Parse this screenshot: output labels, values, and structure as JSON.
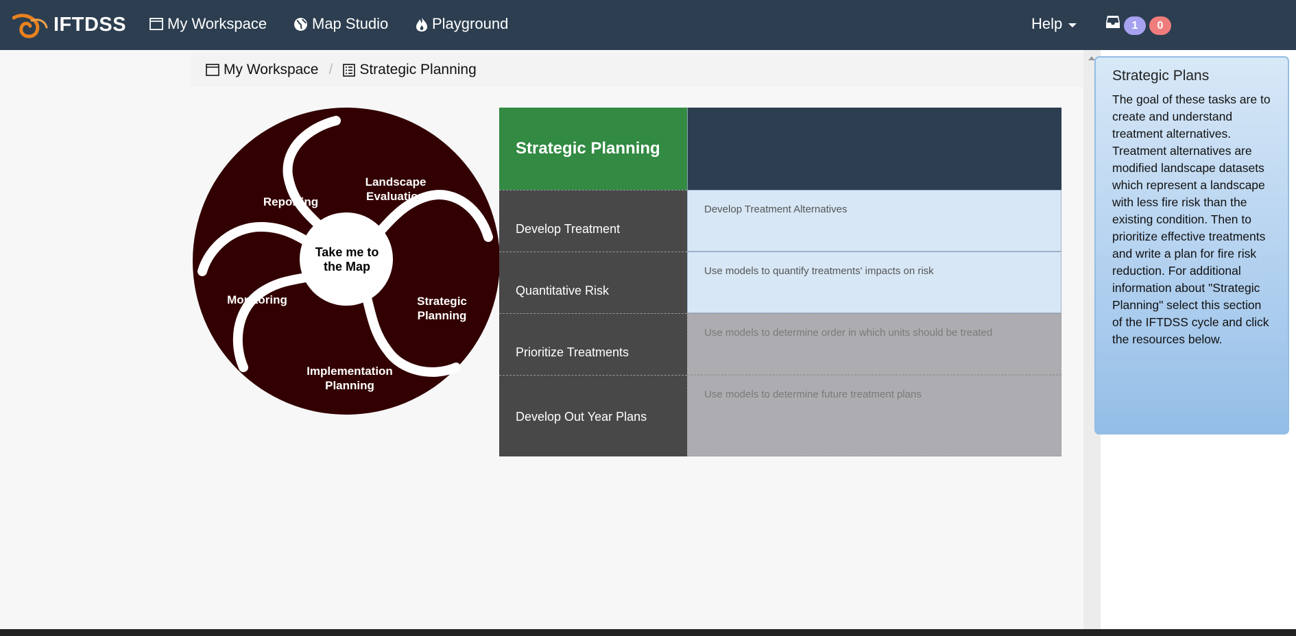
{
  "navbar": {
    "brand": "IFTDSS",
    "links": [
      {
        "label": "My Workspace",
        "icon": "window-icon"
      },
      {
        "label": "Map Studio",
        "icon": "globe-icon"
      },
      {
        "label": "Playground",
        "icon": "fire-icon"
      }
    ],
    "help_label": "Help",
    "badges": {
      "notifications": "1",
      "alerts": "0"
    },
    "colors": {
      "background": "#2c3e50",
      "badge_purple": "#a6a2f0",
      "badge_red": "#f07c7c"
    }
  },
  "breadcrumb": {
    "items": [
      {
        "label": "My Workspace",
        "icon": "window-icon"
      },
      {
        "label": "Strategic Planning",
        "icon": "list-icon"
      }
    ],
    "separator": "/"
  },
  "cycle": {
    "segments": [
      "Reporting",
      "Landscape Evaluation",
      "Strategic Planning",
      "Implementation Planning",
      "Monitoring"
    ],
    "center": "Take me to the Map",
    "color": "#320000"
  },
  "tasks": {
    "header": "Strategic Planning",
    "rows": [
      {
        "label": "Develop Treatment",
        "description": "Develop Treatment Alternatives",
        "state": "active"
      },
      {
        "label": "Quantitative Risk",
        "description": "Use models to quantify treatments' impacts on risk",
        "state": "active"
      },
      {
        "label": "Prioritize Treatments",
        "description": "Use models to determine order in which units should be treated",
        "state": "inactive"
      },
      {
        "label": "Develop Out Year Plans",
        "description": "Use models to determine future treatment plans",
        "state": "inactive"
      }
    ],
    "colors": {
      "header": "#328a43",
      "label_bg": "#484848",
      "active_bg": "#d7e7f6",
      "inactive_bg": "#adadb1"
    }
  },
  "panel": {
    "title": "Strategic Plans",
    "body": "The goal of these tasks are to create and understand treatment alternatives. Treatment alternatives are modified landscape datasets which represent a landscape with less fire risk than the existing condition. Then to prioritize effective treatments and write a plan for fire risk reduction. For additional information about \"Strategic Planning\" select this section of the IFTDSS cycle and click the resources below."
  }
}
